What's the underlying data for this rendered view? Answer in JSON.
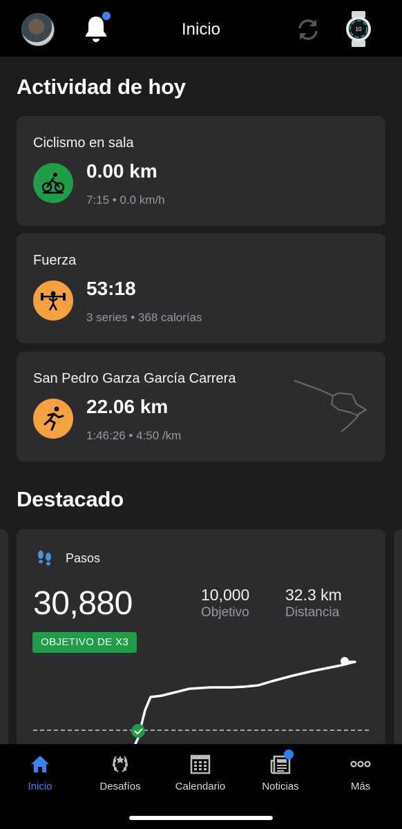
{
  "header": {
    "title": "Inicio"
  },
  "today": {
    "title": "Actividad de hoy",
    "activities": [
      {
        "name": "Ciclismo en sala",
        "main": "0.00 km",
        "sub": "7:15 • 0.0 km/h",
        "icon": "indoor-cycling-icon",
        "color": "#1f9d47"
      },
      {
        "name": "Fuerza",
        "main": "53:18",
        "sub": "3 series • 368 calorías",
        "icon": "strength-icon",
        "color": "#f5a142"
      },
      {
        "name": "San Pedro Garza García Carrera",
        "main": "22.06 km",
        "sub": "1:46:26 • 4:50 /km",
        "icon": "running-icon",
        "color": "#f5a142"
      }
    ]
  },
  "featured": {
    "title": "Destacado",
    "steps": {
      "label": "Pasos",
      "value": "30,880",
      "goal_value": "10,000",
      "goal_label": "Objetivo",
      "distance_value": "32.3 km",
      "distance_label": "Distancia",
      "badge": "OBJETIVO DE X3"
    }
  },
  "nav": [
    {
      "label": "Inicio",
      "icon": "home-icon",
      "active": true
    },
    {
      "label": "Desafíos",
      "icon": "laurel-icon"
    },
    {
      "label": "Calendario",
      "icon": "calendar-icon"
    },
    {
      "label": "Noticias",
      "icon": "news-icon"
    },
    {
      "label": "Más",
      "icon": "more-icon"
    }
  ],
  "colors": {
    "accent": "#3b82f6",
    "green": "#1f9d47",
    "orange": "#f5a142",
    "card": "#2c2c2e"
  }
}
